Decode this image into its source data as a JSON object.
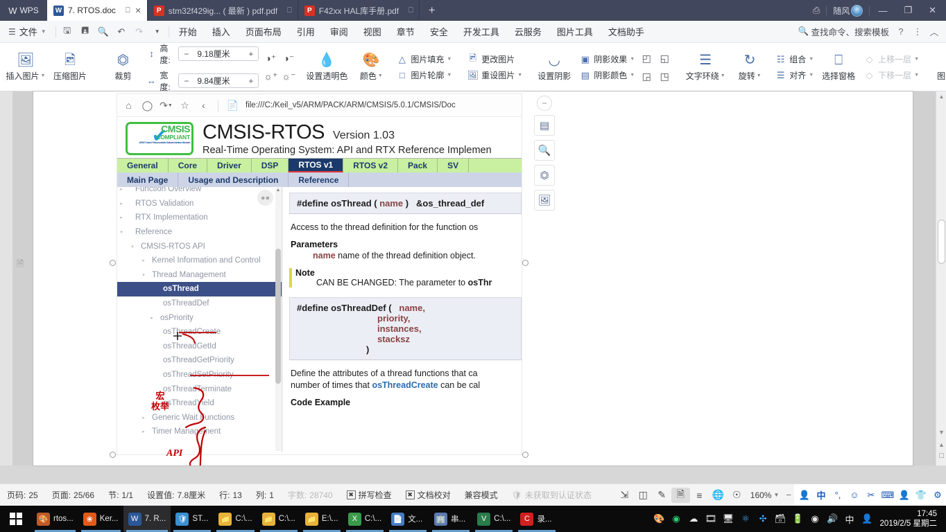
{
  "titlebar": {
    "app_name": "WPS",
    "tabs": [
      {
        "label": "7. RTOS.doc",
        "type": "word",
        "icon": "W",
        "active": true
      },
      {
        "label": "stm32f429ig... ( 最新 ) pdf.pdf",
        "type": "pdf",
        "icon": "P",
        "active": false
      },
      {
        "label": "F42xx HAL库手册.pdf",
        "type": "pdf",
        "icon": "P",
        "active": false
      }
    ],
    "new_tab": "+",
    "user_name": "随风",
    "minimize": "—",
    "restore": "❐",
    "close": "✕"
  },
  "menubar": {
    "file_label": "文件",
    "quick": [
      "save-icon",
      "save-as-icon",
      "print-preview-icon",
      "undo-icon",
      "redo-icon",
      "customize-icon"
    ],
    "items": [
      "开始",
      "插入",
      "页面布局",
      "引用",
      "审阅",
      "视图",
      "章节",
      "安全",
      "开发工具",
      "云服务",
      "图片工具",
      "文档助手"
    ],
    "active_item": "图片工具",
    "search_placeholder": "查找命令、搜索模板",
    "help": "?",
    "more": "⋮",
    "collapse": "︿"
  },
  "ribbon": {
    "insert_picture": "插入图片",
    "compress_picture": "压缩图片",
    "crop": "裁剪",
    "height_label": "高度:",
    "height_value": "9.18厘米",
    "width_label": "宽度:",
    "width_value": "9.84厘米",
    "minus": "−",
    "plus": "+",
    "set_transparent": "设置透明色",
    "color": "颜色",
    "picture_fill": "图片填充",
    "picture_outline": "图片轮廓",
    "change_picture": "更改图片",
    "reset_picture": "重设图片",
    "set_shadow": "设置阴影",
    "shadow_effect": "阴影效果",
    "shadow_color": "阴影颜色",
    "text_wrap": "文字环绕",
    "rotate": "旋转",
    "group": "组合",
    "align": "对齐",
    "selection_pane": "选择窗格",
    "bring_forward": "上移一层",
    "send_backward": "下移一层",
    "picture_convert": "图片转文"
  },
  "image_toolbar": {
    "items": [
      "minus-icon",
      "layout-options-icon",
      "zoom-in-icon",
      "crop-icon",
      "reset-picture-icon"
    ]
  },
  "screenshot": {
    "browser": {
      "home": "⌂",
      "refresh": "◯",
      "history": "↺",
      "favorite": "☆",
      "back": "‹",
      "url": "file:///C:/Keil_v5/ARM/PACK/ARM/CMSIS/5.0.1/CMSIS/Doc"
    },
    "header": {
      "logo_main": "CMSIS",
      "logo_sub": "COMPLIANT",
      "logo_fine": "ARM® Cortex® Microcontroller Software Interface Standard",
      "title": "CMSIS-RTOS",
      "version": "Version 1.03",
      "subtitle": "Real-Time Operating System: API and RTX Reference Implemen"
    },
    "tabs_primary": [
      "General",
      "Core",
      "Driver",
      "DSP",
      "RTOS v1",
      "RTOS v2",
      "Pack",
      "SV"
    ],
    "tabs_primary_active": "RTOS v1",
    "tabs_secondary": [
      "Main Page",
      "Usage and Description",
      "Reference"
    ],
    "tree": [
      {
        "label": "Function Overview",
        "indent": 1,
        "arrow": "▶",
        "state": "partial"
      },
      {
        "label": "RTOS Validation",
        "indent": 1,
        "arrow": "▶"
      },
      {
        "label": "RTX Implementation",
        "indent": 1,
        "arrow": "▶"
      },
      {
        "label": "Reference",
        "indent": 1,
        "arrow": "▼",
        "underlined": true
      },
      {
        "label": "CMSIS-RTOS API",
        "indent": 2,
        "arrow": "▼"
      },
      {
        "label": "Kernel Information and Control",
        "indent": 3,
        "arrow": "▶"
      },
      {
        "label": "Thread Management",
        "indent": 3,
        "arrow": "▼",
        "underlined": true
      },
      {
        "label": "osThread",
        "indent": 4,
        "arrow": "",
        "selected": true
      },
      {
        "label": "osThreadDef",
        "indent": 4,
        "arrow": ""
      },
      {
        "label": "osPriority",
        "indent": 3,
        "arrow": "▶"
      },
      {
        "label": "osThreadCreate",
        "indent": 4,
        "arrow": ""
      },
      {
        "label": "osThreadGetId",
        "indent": 4,
        "arrow": ""
      },
      {
        "label": "osThreadGetPriority",
        "indent": 4,
        "arrow": ""
      },
      {
        "label": "osThreadSetPriority",
        "indent": 4,
        "arrow": ""
      },
      {
        "label": "osThreadTerminate",
        "indent": 4,
        "arrow": ""
      },
      {
        "label": "osThreadYield",
        "indent": 4,
        "arrow": ""
      },
      {
        "label": "Generic Wait Functions",
        "indent": 3,
        "arrow": "▶"
      },
      {
        "label": "Timer Management",
        "indent": 3,
        "arrow": "▶"
      }
    ],
    "content": {
      "proto1_prefix": "#define osThread (",
      "proto1_arg": "name",
      "proto1_suffix": ")",
      "proto1_tail": "&os_thread_def",
      "desc1": "Access to the thread definition for the function os",
      "desc1_link": "os",
      "parameters_heading": "Parameters",
      "param_name": "name",
      "param_desc": "name of the thread definition object.",
      "note_heading": "Note",
      "note_text": "CAN BE CHANGED: The parameter to",
      "note_bold": "osThr",
      "proto2_prefix": "#define osThreadDef (",
      "proto2_args": [
        "name,",
        "priority,",
        "instances,",
        "stacksz"
      ],
      "proto2_close": ")",
      "desc2_line1": "Define the attributes of a thread functions that ca",
      "desc2_line2_a": "number of times that",
      "desc2_link": "osThreadCreate",
      "desc2_line2_b": "can be cal",
      "code_example_heading": "Code Example"
    },
    "annotations": {
      "macro_line1": "宏",
      "macro_line2": "枚举",
      "api": "API"
    }
  },
  "statusbar": {
    "page_no_label": "页码:",
    "page_no": "25",
    "page_label": "页面:",
    "page": "25/66",
    "section_label": "节:",
    "section": "1/1",
    "setting_label": "设置值:",
    "setting": "7.8厘米",
    "row_label": "行:",
    "row": "13",
    "col_label": "列:",
    "col": "1",
    "wordcount_label": "字数:",
    "wordcount": "28740",
    "spellcheck": "拼写检查",
    "proofread": "文档校对",
    "compat_mode": "兼容模式",
    "auth_status": "未获取到认证状态",
    "view_icons": [
      "fullscreen-icon",
      "two-page-icon",
      "pen-icon",
      "page-view-icon",
      "outline-view-icon",
      "web-view-icon",
      "eye-icon"
    ],
    "zoom": "160%",
    "zoom_out": "−",
    "tray": [
      "avatar-icon",
      "中",
      "ime-status-icon",
      "smiley-icon",
      "scissors-icon",
      "keyboard-icon",
      "person-icon",
      "shirt-icon",
      "gear-icon"
    ],
    "ime_label": "中"
  },
  "taskbar": {
    "start": "start-icon",
    "buttons": [
      {
        "label": "rtos...",
        "icon": "🎨",
        "color": "#c05a2a",
        "active": false
      },
      {
        "label": "Ker...",
        "icon": "🦊",
        "color": "#e05a1a",
        "active": false
      },
      {
        "label": "7. R...",
        "icon": "W",
        "color": "#2b5797",
        "active": true
      },
      {
        "label": "ST...",
        "icon": "🛡",
        "color": "#3a8fd0",
        "active": false
      },
      {
        "label": "C:\\...",
        "icon": "📁",
        "color": "#e8b23a",
        "active": false
      },
      {
        "label": "C:\\...",
        "icon": "📁",
        "color": "#e8b23a",
        "active": false
      },
      {
        "label": "E:\\...",
        "icon": "📁",
        "color": "#e8b23a",
        "active": false
      },
      {
        "label": "C:\\...",
        "icon": "📗",
        "color": "#3a9a4a",
        "active": false
      },
      {
        "label": "文...",
        "icon": "📘",
        "color": "#4a7ac0",
        "active": false
      },
      {
        "label": "串...",
        "icon": "🏢",
        "color": "#5a7ab0",
        "active": false
      },
      {
        "label": "C:\\...",
        "icon": "V",
        "color": "#2a7a4a",
        "active": false
      },
      {
        "label": "录...",
        "icon": "C",
        "color": "#d02020",
        "active": false
      }
    ],
    "tray_icons": [
      "palette-icon",
      "at-icon",
      "cloud-icon",
      "media-icon",
      "network-icon",
      "drive-icon",
      "bluetooth-icon",
      "usb-icon",
      "battery-icon",
      "wifi-icon",
      "volume-icon"
    ],
    "ime": "中",
    "user": "person-icon",
    "time": "17:45",
    "date": "2019/2/5 星期二"
  }
}
